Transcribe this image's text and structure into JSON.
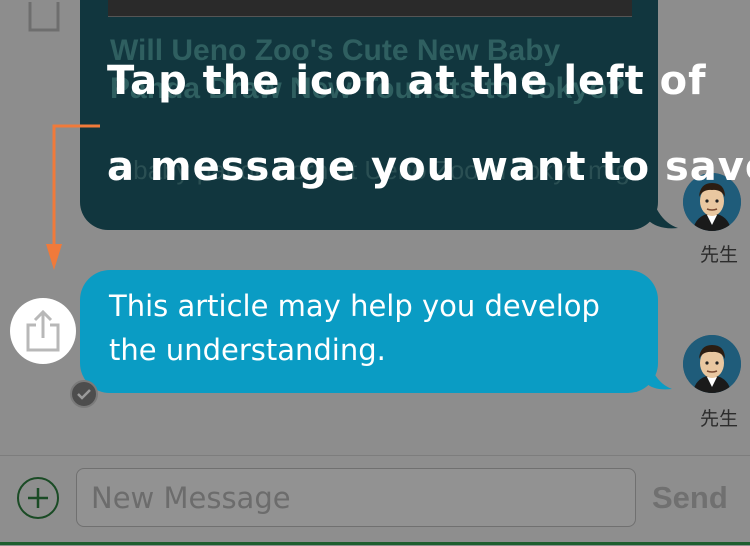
{
  "card": {
    "title": "Will Ueno Zoo's Cute New Baby Panda Draw New Tourists to Tokyo?",
    "description": "A baby panda born at Ueno Zoo in Tokyo might..."
  },
  "message": {
    "text": "This article may help you develop the understanding."
  },
  "senders": [
    {
      "name": "先生"
    },
    {
      "name": "先生"
    }
  ],
  "overlay": {
    "line1": "Tap the icon at the left of",
    "line2": "a message you want to save"
  },
  "input": {
    "placeholder": "New Message",
    "send_label": "Send"
  },
  "icons": {
    "share": "share-icon",
    "check": "check-icon",
    "add": "plus-icon",
    "arrow": "arrow-icon",
    "avatar": "teacher-avatar"
  },
  "colors": {
    "card_bubble": "#11363e",
    "message_bubble": "#0a9cc4",
    "arrow": "#f07a3a",
    "overlay_text": "#ffffff"
  }
}
